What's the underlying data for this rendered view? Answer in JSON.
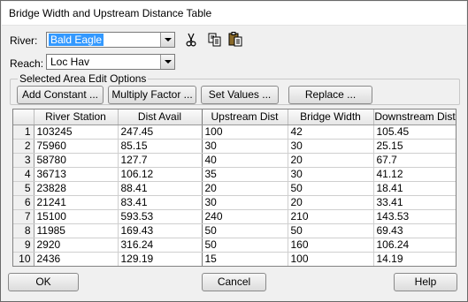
{
  "window": {
    "title": "Bridge Width and Upstream Distance Table"
  },
  "river": {
    "label": "River:",
    "value": "Bald Eagle"
  },
  "reach": {
    "label": "Reach:",
    "value": "Loc Hav"
  },
  "toolbar": {
    "cut_icon": "scissors-icon",
    "copy_icon": "copy-icon",
    "paste_icon": "paste-icon"
  },
  "area_edit": {
    "title": "Selected Area Edit Options",
    "add_constant": "Add Constant ...",
    "multiply_factor": "Multiply Factor ...",
    "set_values": "Set Values ...",
    "replace": "Replace ..."
  },
  "table": {
    "columns": [
      "River Station",
      "Dist Avail",
      "Upstream Dist",
      "Bridge Width",
      "Downstream Dist"
    ],
    "rows": [
      [
        "1",
        "103245",
        "247.45",
        "100",
        "42",
        "105.45"
      ],
      [
        "2",
        "75960",
        "85.15",
        "30",
        "30",
        "25.15"
      ],
      [
        "3",
        "58780",
        "127.7",
        "40",
        "20",
        "67.7"
      ],
      [
        "4",
        "36713",
        "106.12",
        "35",
        "30",
        "41.12"
      ],
      [
        "5",
        "23828",
        "88.41",
        "20",
        "50",
        "18.41"
      ],
      [
        "6",
        "21241",
        "83.41",
        "30",
        "20",
        "33.41"
      ],
      [
        "7",
        "15100",
        "593.53",
        "240",
        "210",
        "143.53"
      ],
      [
        "8",
        "11985",
        "169.43",
        "50",
        "50",
        "69.43"
      ],
      [
        "9",
        "2920",
        "316.24",
        "50",
        "160",
        "106.24"
      ],
      [
        "10",
        "2436",
        "129.19",
        "15",
        "100",
        "14.19"
      ]
    ]
  },
  "footer": {
    "ok": "OK",
    "cancel": "Cancel",
    "help": "Help"
  }
}
